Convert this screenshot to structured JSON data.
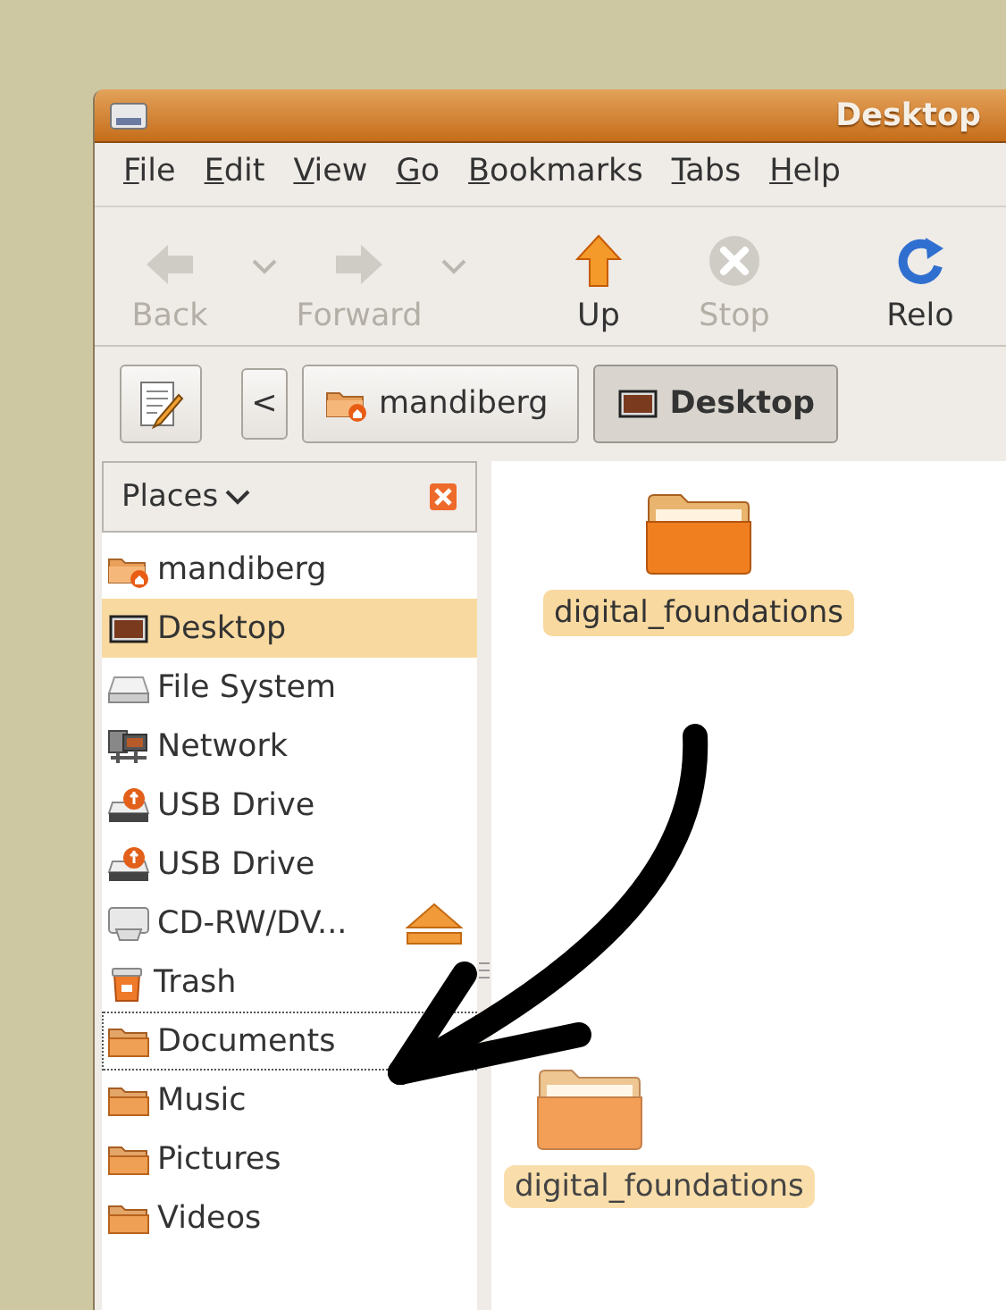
{
  "window": {
    "title": "Desktop"
  },
  "menu": [
    {
      "label": "File"
    },
    {
      "label": "Edit"
    },
    {
      "label": "View"
    },
    {
      "label": "Go"
    },
    {
      "label": "Bookmarks"
    },
    {
      "label": "Tabs"
    },
    {
      "label": "Help"
    }
  ],
  "toolbar": [
    {
      "kind": "back",
      "label": "Back",
      "disabled": true
    },
    {
      "kind": "caret",
      "disabled": true
    },
    {
      "kind": "forward",
      "label": "Forward",
      "disabled": true
    },
    {
      "kind": "caret",
      "disabled": true
    },
    {
      "kind": "up",
      "label": "Up",
      "disabled": false
    },
    {
      "kind": "stop",
      "label": "Stop",
      "disabled": true
    },
    {
      "kind": "reload",
      "label": "Relo",
      "disabled": false
    }
  ],
  "location": {
    "scroll_left": "<",
    "path": [
      {
        "kind": "home",
        "label": "mandiberg",
        "selected": false
      },
      {
        "kind": "desktop",
        "label": "Desktop",
        "selected": true
      }
    ]
  },
  "sidebar": {
    "title": "Places",
    "items": [
      {
        "kind": "home",
        "label": "mandiberg",
        "selected": false,
        "drop_target": false
      },
      {
        "kind": "desktop",
        "label": "Desktop",
        "selected": true,
        "drop_target": false
      },
      {
        "kind": "drive",
        "label": "File System",
        "selected": false,
        "drop_target": false
      },
      {
        "kind": "network",
        "label": "Network",
        "selected": false,
        "drop_target": false
      },
      {
        "kind": "usb",
        "label": "USB Drive",
        "selected": false,
        "drop_target": false
      },
      {
        "kind": "usb",
        "label": "USB Drive",
        "selected": false,
        "drop_target": false
      },
      {
        "kind": "cdrom",
        "label": "CD-RW/DV...",
        "selected": false,
        "drop_target": false,
        "ejectable": true
      },
      {
        "kind": "trash",
        "label": "Trash",
        "selected": false,
        "drop_target": false
      },
      {
        "kind": "folder",
        "label": "Documents",
        "selected": false,
        "drop_target": true
      },
      {
        "kind": "folder",
        "label": "Music",
        "selected": false,
        "drop_target": false
      },
      {
        "kind": "folder",
        "label": "Pictures",
        "selected": false,
        "drop_target": false
      },
      {
        "kind": "folder",
        "label": "Videos",
        "selected": false,
        "drop_target": false
      }
    ]
  },
  "content": {
    "items": [
      {
        "kind": "folder",
        "label": "digital_foundations",
        "selected": true
      }
    ]
  },
  "drag": {
    "label": "digital_foundations"
  }
}
